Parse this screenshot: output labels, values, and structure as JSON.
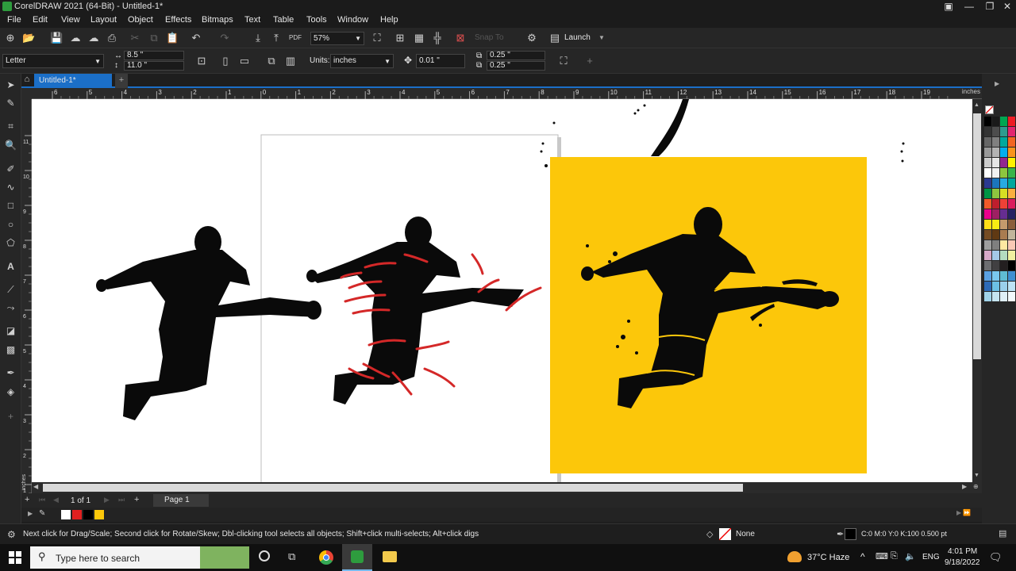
{
  "titlebar": {
    "title": "CorelDRAW 2021 (64-Bit) - Untitled-1*"
  },
  "menu": [
    "File",
    "Edit",
    "View",
    "Layout",
    "Object",
    "Effects",
    "Bitmaps",
    "Text",
    "Table",
    "Tools",
    "Window",
    "Help"
  ],
  "toolbar": {
    "zoom": "57%",
    "snap_to": "Snap To",
    "launch": "Launch"
  },
  "props": {
    "page_size": "Letter",
    "width": "8.5 \"",
    "height": "11.0 \"",
    "units_label": "Units:",
    "units_value": "inches",
    "nudge": "0.01 \"",
    "dup_x": "0.25 \"",
    "dup_y": "0.25 \""
  },
  "doc_tab": "Untitled-1*",
  "ruler": {
    "unit": "inches",
    "h_labels": [
      "6",
      "5",
      "4",
      "3",
      "2",
      "1",
      "0",
      "1",
      "2",
      "3",
      "4",
      "5",
      "6",
      "7",
      "8",
      "9",
      "10",
      "11",
      "12",
      "13",
      "14",
      "15",
      "16",
      "17",
      "18",
      "19"
    ],
    "v_labels": [
      "11",
      "10",
      "9",
      "8",
      "7",
      "6",
      "5",
      "4",
      "3",
      "2",
      "1"
    ]
  },
  "pagebar": {
    "page_count": "1 of 1",
    "page_tab": "Page 1"
  },
  "status": {
    "hint": "Next click for Drag/Scale; Second click for Rotate/Skew; Dbl-clicking tool selects all objects; Shift+click multi-selects; Alt+click digs",
    "fill": "None",
    "outline": "C:0 M:0 Y:0 K:100  0.500 pt"
  },
  "taskbar": {
    "search_placeholder": "Type here to search",
    "weather": "37°C  Haze",
    "lang": "ENG",
    "time": "4:01 PM",
    "date": "9/18/2022"
  },
  "colors": {
    "accent": "#1b6fc8",
    "yellow_bg": "#fcc70a",
    "silhouette": "#0a0a0a",
    "red_strokes": "#d42828"
  },
  "document_colors": [
    "#ffffff",
    "#e02020",
    "#000000",
    "#fcc70a"
  ],
  "palette": [
    "#000000",
    "#1a1a1a",
    "#00a651",
    "#ed1c24",
    "#333333",
    "#4d4d4d",
    "#2e9c8f",
    "#e2266f",
    "#666666",
    "#808080",
    "#00a99d",
    "#f26522",
    "#999999",
    "#b3b3b3",
    "#00aeef",
    "#f7941d",
    "#cccccc",
    "#e6e6e6",
    "#92278f",
    "#fff200",
    "#ffffff",
    "#f2f2f2",
    "#8dc63f",
    "#39b54a",
    "#2b3990",
    "#1b75bc",
    "#27aae1",
    "#00a79d",
    "#009444",
    "#8dc63f",
    "#d7df23",
    "#fbb040",
    "#f15a29",
    "#be1e2d",
    "#ef4136",
    "#da1c5c",
    "#ec008c",
    "#9e1f63",
    "#662d91",
    "#262262",
    "#ffde17",
    "#f7ec13",
    "#c49a6c",
    "#8b5e3c",
    "#754c24",
    "#603913",
    "#a97c50",
    "#c2b59b",
    "#9e9e9e",
    "#7f7f7f",
    "#ffe8a1",
    "#f9c9b5",
    "#d6a8c8",
    "#a4c8e8",
    "#b4dcc0",
    "#f0f0a0",
    "#6d6e71",
    "#414042",
    "#231f20",
    "#000000",
    "#5aa1e3",
    "#7ac8ef",
    "#5fbcd3",
    "#3f8fd1",
    "#2d6ab7",
    "#6cc0e5",
    "#9ad0ec",
    "#bde3f5",
    "#a0d2e8",
    "#c5e4f0",
    "#dfeff7",
    "#f2f9fc"
  ]
}
